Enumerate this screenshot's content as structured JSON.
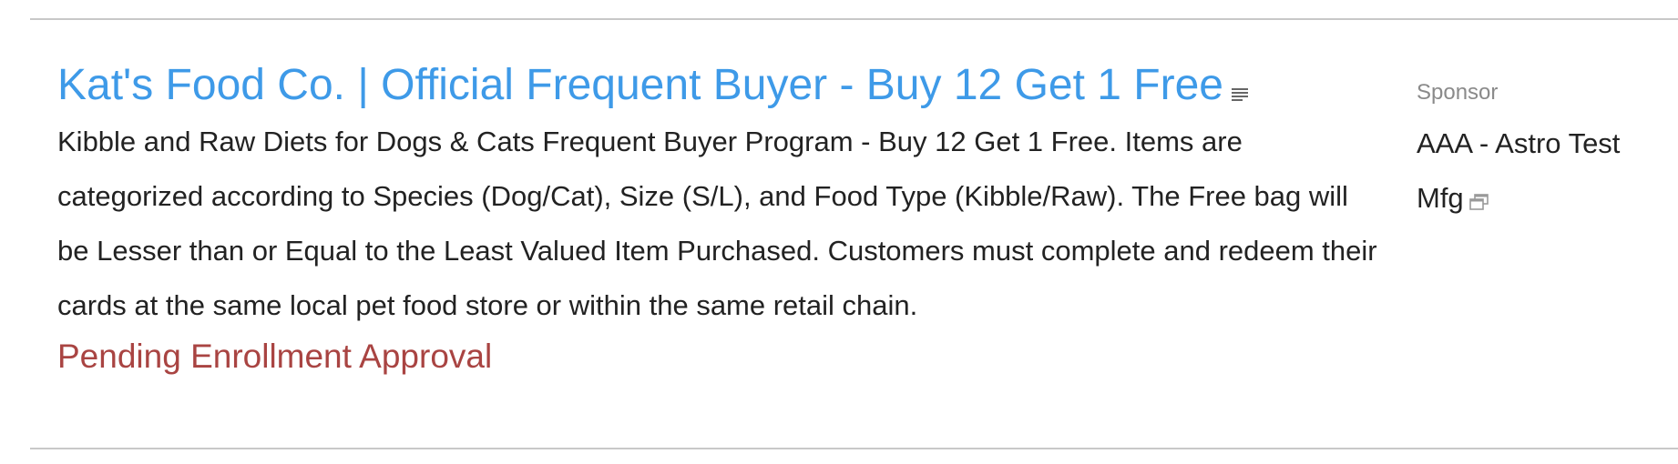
{
  "listing": {
    "title": "Kat's Food Co. | Official Frequent Buyer - Buy 12 Get 1 Free",
    "title_icon": "details-list-icon",
    "description": "Kibble and Raw Diets for Dogs & Cats Frequent Buyer Program - Buy 12 Get 1 Free. Items are categorized according to Species (Dog/Cat), Size (S/L), and Food Type (Kibble/Raw). The Free bag will be Lesser than or Equal to the Least Valued Item Purchased. Customers must complete and redeem their cards at the same local pet food store or within the same retail chain.",
    "status": "Pending Enrollment Approval"
  },
  "sponsor": {
    "label": "Sponsor",
    "name": "AAA - Astro Test Mfg",
    "icon": "open-in-window-icon"
  },
  "colors": {
    "title_link": "#3e9ae8",
    "status_text": "#a94442",
    "muted_label": "#8a8a8a",
    "body_text": "#222222",
    "divider": "#c8c8c8"
  }
}
